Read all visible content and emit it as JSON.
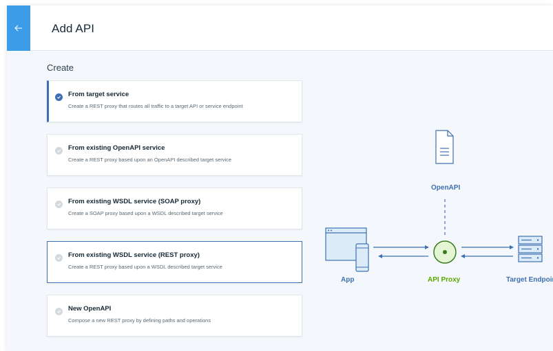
{
  "header": {
    "back_icon": "arrow-left-icon",
    "title": "Add API"
  },
  "section": {
    "title": "Create"
  },
  "options": [
    {
      "title": "From target service",
      "description": "Create a REST proxy that routes all traffic to a target API or service endpoint",
      "selected": true
    },
    {
      "title": "From existing OpenAPI service",
      "description": "Create a REST proxy based upon an OpenAPI described target service",
      "selected": false
    },
    {
      "title": "From existing WSDL service (SOAP proxy)",
      "description": "Create a SOAP proxy based upon a WSDL described target service",
      "selected": false
    },
    {
      "title": "From existing WSDL service (REST proxy)",
      "description": "Create a REST proxy based upon a WSDL described target service",
      "selected": false
    },
    {
      "title": "New OpenAPI",
      "description": "Compose a new REST proxy by defining paths and operations",
      "selected": false
    }
  ],
  "diagram": {
    "openapi_label": "OpenAPI",
    "app_label": "App",
    "proxy_label": "API Proxy",
    "target_label": "Target Endpoint",
    "icons": [
      "document-icon",
      "browser-mobile-icon",
      "api-proxy-icon",
      "server-icon"
    ]
  },
  "colors": {
    "accent": "#3d9ce8",
    "primary_blue": "#3d70b2",
    "proxy_green": "#5aa700",
    "background": "#f4f7fb"
  }
}
